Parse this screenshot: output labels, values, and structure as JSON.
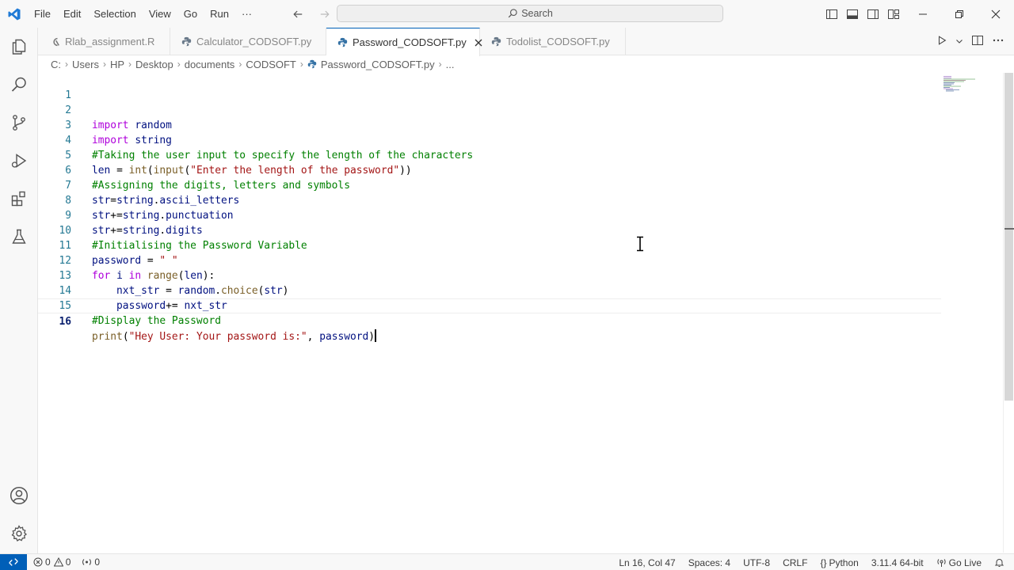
{
  "menu": [
    "File",
    "Edit",
    "Selection",
    "View",
    "Go",
    "Run",
    "···"
  ],
  "search": {
    "label": "Search"
  },
  "tabs": [
    {
      "label": "Rlab_assignment.R",
      "icon": "r-file-icon"
    },
    {
      "label": "Calculator_CODSOFT.py",
      "icon": "python-icon"
    },
    {
      "label": "Password_CODSOFT.py",
      "icon": "python-icon",
      "active": true
    },
    {
      "label": "Todolist_CODSOFT.py",
      "icon": "python-icon"
    }
  ],
  "breadcrumb": [
    "C:",
    "Users",
    "HP",
    "Desktop",
    "documents",
    "CODSOFT",
    "Password_CODSOFT.py",
    "..."
  ],
  "code": {
    "line_numbers": [
      "1",
      "2",
      "3",
      "4",
      "5",
      "6",
      "7",
      "8",
      "9",
      "10",
      "11",
      "12",
      "13",
      "14",
      "15",
      "16"
    ],
    "l2": [
      "import",
      "random"
    ],
    "l3": [
      "import",
      "string"
    ],
    "l4": "#Taking the user input to specify the length of the characters",
    "l5": [
      "len",
      "=",
      "int",
      "(",
      "input",
      "(",
      "\"Enter the length of the password\"",
      "))"
    ],
    "l6": "#Assigning the digits, letters and symbols",
    "l7": [
      "str",
      "=",
      "string",
      ".",
      "ascii_letters"
    ],
    "l8": [
      "str",
      "+=",
      "string",
      ".",
      "punctuation"
    ],
    "l9": [
      "str",
      "+=",
      "string",
      ".",
      "digits"
    ],
    "l10": "#Initialising the Password Variable",
    "l11": [
      "password",
      "=",
      "\" \""
    ],
    "l12": [
      "for",
      "i",
      "in",
      "range",
      "(",
      "len",
      "):"
    ],
    "l13": [
      "nxt_str",
      "=",
      "random",
      ".",
      "choice",
      "(",
      "str",
      ")"
    ],
    "l14": [
      "password",
      "+=",
      "nxt_str"
    ],
    "l15": "#Display the Password",
    "l16": [
      "print",
      "(",
      "\"Hey User: Your password is:\"",
      ", ",
      "password",
      ")"
    ]
  },
  "status": {
    "errors": "0",
    "warnings": "0",
    "ports": "0",
    "position": "Ln 16, Col 47",
    "spaces": "Spaces: 4",
    "encoding": "UTF-8",
    "eol": "CRLF",
    "language": "Python",
    "interpreter": "3.11.4 64-bit",
    "golive": "Go Live"
  },
  "colors": {
    "accent": "#005fb8",
    "keyword": "#af00db",
    "function": "#795e26",
    "string": "#a31515",
    "comment": "#008000",
    "identifier": "#001080",
    "line_number": "#237893"
  }
}
